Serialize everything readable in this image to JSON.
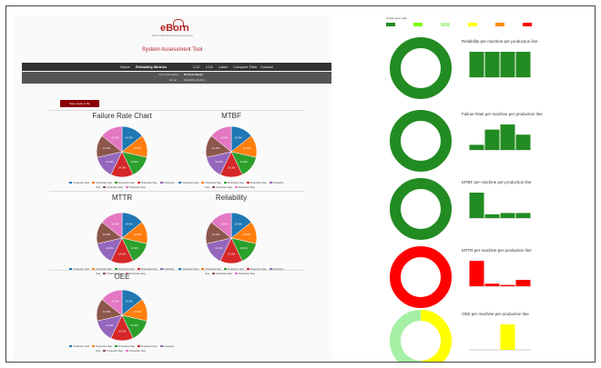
{
  "app": {
    "logo_text": "eBorn",
    "logo_subtitle": "Smart Manufacturing Assessment",
    "title": "System Assessment Tool"
  },
  "nav": {
    "items": [
      "Home",
      "Reliability Metrics",
      "LCC",
      "LCA",
      "Label",
      "Compare Files",
      "Contact"
    ],
    "active_index": 1
  },
  "subnav": {
    "items": [
      "View Information",
      "Perform Study"
    ],
    "active_index": 1,
    "breadcrumb": [
      "Home",
      "Reliability Metrics"
    ]
  },
  "save_button": "Save study to file",
  "pie_charts": [
    {
      "title": "Failure Rate Chart",
      "slices": [
        "14.3%",
        "14.3%",
        "14.3%",
        "14.3%",
        "14.3%",
        "14.3%",
        "14.3%"
      ]
    },
    {
      "title": "MTBF",
      "slices": [
        "14.3%",
        "14.3%",
        "14.3%",
        "14.3%",
        "14.3%",
        "14.3%",
        "14.3%"
      ]
    },
    {
      "title": "MTTR",
      "slices": [
        "14.3%",
        "14.3%",
        "14.3%",
        "14.3%",
        "14.3%",
        "14.3%",
        "14.3%"
      ]
    },
    {
      "title": "Reliability",
      "slices": [
        "14.3%",
        "14.3%",
        "14.3%",
        "14.3%",
        "14.3%",
        "14.3%",
        "14.3%"
      ]
    },
    {
      "title": "OEE",
      "slices": [
        "14.3%",
        "14.3%",
        "14.3%",
        "14.3%",
        "14.3%",
        "14.3%",
        "14.3%"
      ]
    }
  ],
  "pie_legend": [
    "Production Step",
    "Production Step",
    "Production Step",
    "Production Step",
    "Production Step",
    "Production Step",
    "Production Step"
  ],
  "pie_colors": [
    "#1f77b4",
    "#ff7f0e",
    "#2ca02c",
    "#d62728",
    "#9467bd",
    "#8c564b",
    "#e377c2"
  ],
  "right_legend": {
    "label": "Grade color code",
    "colors": [
      "#228b22",
      "#7cfc00",
      "#b9f5a5",
      "#ffff00",
      "#ff8c00",
      "#ff0000"
    ]
  },
  "metrics": [
    {
      "title": "Reliability per machine per production line",
      "donut_color": "#228b22",
      "donut_secondary": null,
      "donut_fraction": 1.0,
      "bar_color": "#228b22",
      "bars": [
        1.0,
        1.0,
        1.0,
        1.0
      ]
    },
    {
      "title": "Failure Rate per machine per production line",
      "donut_color": "#228b22",
      "donut_secondary": null,
      "donut_fraction": 1.0,
      "bar_color": "#228b22",
      "bars": [
        0.2,
        0.8,
        1.0,
        0.6
      ]
    },
    {
      "title": "MTBF per machine per production line",
      "donut_color": "#228b22",
      "donut_secondary": null,
      "donut_fraction": 1.0,
      "bar_color": "#228b22",
      "bars": [
        1.0,
        0.15,
        0.2,
        0.2
      ]
    },
    {
      "title": "MTTR per machine per production line",
      "donut_color": "#ff0000",
      "donut_secondary": null,
      "donut_fraction": 1.0,
      "bar_color": "#ff0000",
      "bars": [
        1.0,
        0.1,
        0.05,
        0.25
      ]
    },
    {
      "title": "OEE per machine per production line",
      "donut_color": "#ffff00",
      "donut_secondary": "#a5f0a5",
      "donut_fraction": 0.5,
      "bar_color": "#ffff00",
      "bars": [
        0.0,
        0.0,
        1.0,
        0.0
      ]
    }
  ]
}
